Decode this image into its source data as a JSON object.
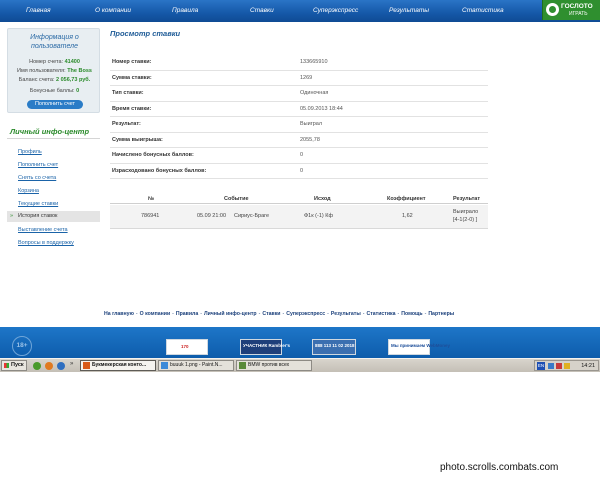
{
  "nav": {
    "items": [
      "Главная",
      "О компании",
      "Правила",
      "Ставки",
      "Суперэкспресс",
      "Результаты",
      "Статистика"
    ]
  },
  "logo": {
    "text": "ГОСЛОТО",
    "sub": "ИГРАТЬ"
  },
  "user_box": {
    "title_line1": "Информация о",
    "title_line2": "пользователе",
    "account_label": "Номер счета:",
    "account_value": "41400",
    "username_label": "Имя пользователя:",
    "username_value": "The Boss",
    "balance_label": "Баланс счета:",
    "balance_value": "2 056,73 руб.",
    "bonus_label": "Бонусные баллы:",
    "bonus_value": "0",
    "top_up_button": "Пополнить счет"
  },
  "sidebar": {
    "title": "Личный инфо-центр",
    "items": [
      {
        "label": "Профиль"
      },
      {
        "label": "Пополнить счет"
      },
      {
        "label": "Снять со счета"
      },
      {
        "label": "Корзина"
      },
      {
        "label": "Текущие ставки"
      },
      {
        "label": "История ставок"
      },
      {
        "label": "Выставление счета"
      },
      {
        "label": "Вопросы в поддержку"
      }
    ],
    "active_index": 5
  },
  "main": {
    "title": "Просмотр ставки",
    "details": [
      {
        "label": "Номер ставки:",
        "value": "133665910"
      },
      {
        "label": "Сумма ставки:",
        "value": "1269"
      },
      {
        "label": "Тип ставки:",
        "value": "Одиночная"
      },
      {
        "label": "Время ставки:",
        "value": "05.09.2013 18:44"
      },
      {
        "label": "Результат:",
        "value": "Выиграл"
      },
      {
        "label": "Сумма выигрыша:",
        "value": "2055,78"
      },
      {
        "label": "Начислено бонусных баллов:",
        "value": "0"
      },
      {
        "label": "Израсходовано бонусных баллов:",
        "value": "0"
      }
    ],
    "bets_table": {
      "columns": [
        "№",
        "Событие",
        "Исход",
        "Коэффициент",
        "Результат"
      ],
      "row": {
        "number": "786941",
        "event_time": "05.09 21:00",
        "event_name": "Сириус-Браге",
        "outcome": "Ф1к (-1) Кф",
        "coefficient": "1,62",
        "result_line1": "Выиграло",
        "result_line2": "[4-1(2-0) ]"
      }
    }
  },
  "footer": {
    "links": [
      "На главную",
      "О компании",
      "Правила",
      "Личный инфо-центр",
      "Ставки",
      "Суперэкспресс",
      "Результаты",
      "Статистика",
      "Помощь",
      "Партнеры"
    ],
    "separator": "-",
    "age": "18+",
    "badges": [
      {
        "text": "170"
      },
      {
        "text": "УЧАСТНИК Rambler's"
      },
      {
        "text": "888 113 11 02 2018"
      },
      {
        "text": "Мы принимаем WebMoney"
      }
    ]
  },
  "taskbar": {
    "start": "Пуск",
    "tasks": [
      {
        "label": "Букмекерская конто..."
      },
      {
        "label": "buuuk 1.png - Paint.N..."
      },
      {
        "label": "BMW против всех"
      }
    ],
    "active_task": 0,
    "lang": "EN",
    "time": "14:21"
  },
  "watermark": "photo.scrolls.combats.com",
  "colors": {
    "nav_blue": "#1558a8",
    "accent_green": "#2a8a2a",
    "link_blue": "#1a63a8",
    "footer_blue": "#0d5cab"
  }
}
